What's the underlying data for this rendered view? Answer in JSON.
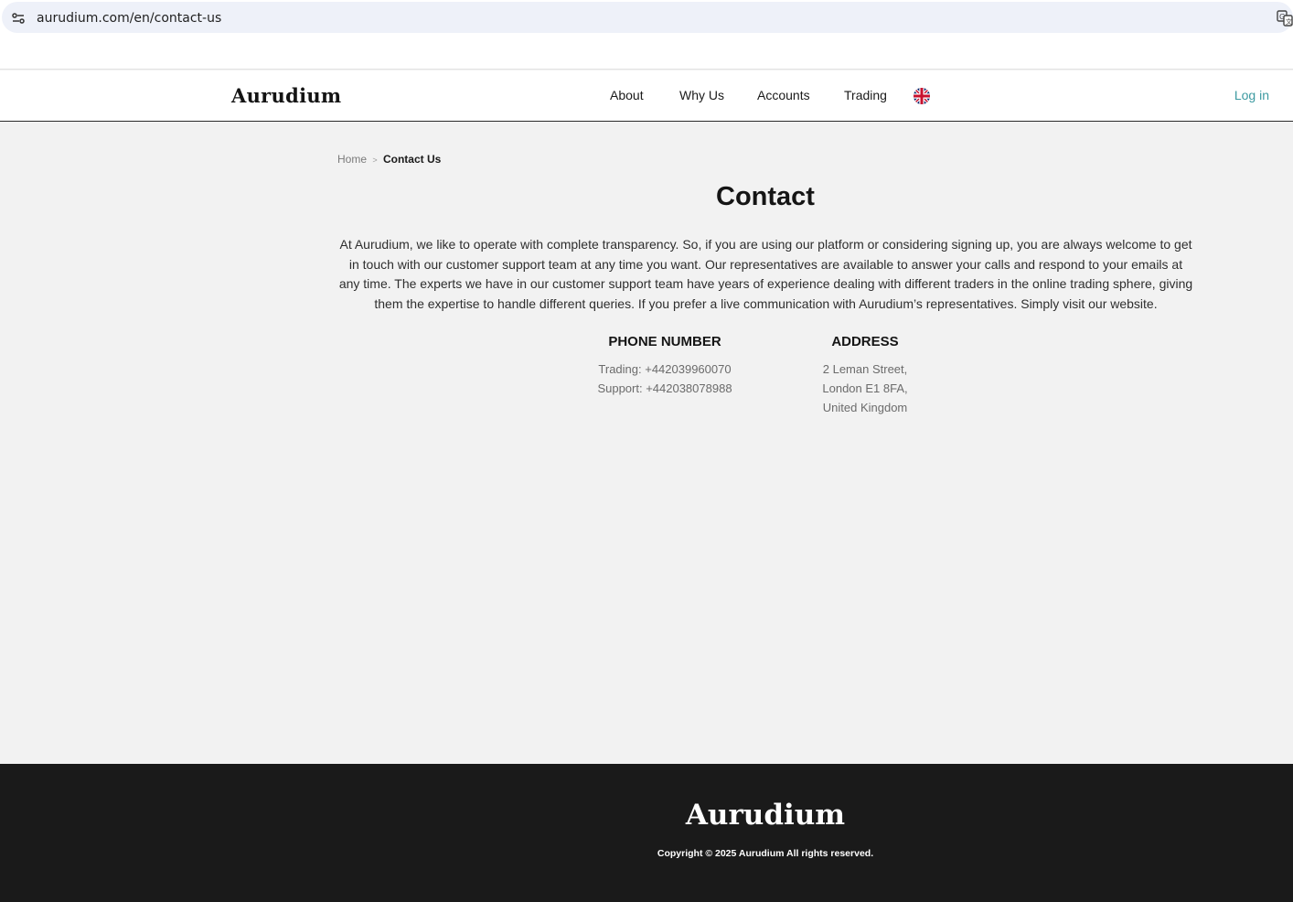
{
  "browser": {
    "url": "aurudium.com/en/contact-us",
    "icons": [
      "site-info-icon",
      "translate-icon"
    ]
  },
  "header": {
    "logo": "Aurudium",
    "nav": [
      "About",
      "Why Us",
      "Accounts",
      "Trading"
    ],
    "language_icon": "uk-flag-icon",
    "login": "Log in",
    "accent_color": "#3d9aa1"
  },
  "breadcrumb": {
    "home": "Home",
    "separator": ">",
    "current": "Contact Us"
  },
  "main": {
    "title": "Contact",
    "intro": "At Aurudium, we like to operate with complete transparency. So, if you are using our platform or considering signing up, you are always welcome to get in touch with our customer support team at any time you want. Our representatives are available to answer your calls and respond to your emails at any time. The experts we have in our customer support team have years of experience dealing with different traders in the online trading sphere, giving them the expertise to handle different queries. If you prefer a live communication with Aurudium’s representatives. Simply visit our website.",
    "phone": {
      "heading": "PHONE NUMBER",
      "lines": [
        "Trading: +442039960070",
        "Support: +442038078988"
      ]
    },
    "address": {
      "heading": "ADDRESS",
      "lines": [
        "2 Leman Street,",
        "London E1 8FA,",
        "United Kingdom"
      ]
    }
  },
  "footer": {
    "logo": "Aurudium",
    "copyright": "Copyright © 2025 Aurudium All rights reserved.",
    "background_color": "#1a1a1a"
  }
}
